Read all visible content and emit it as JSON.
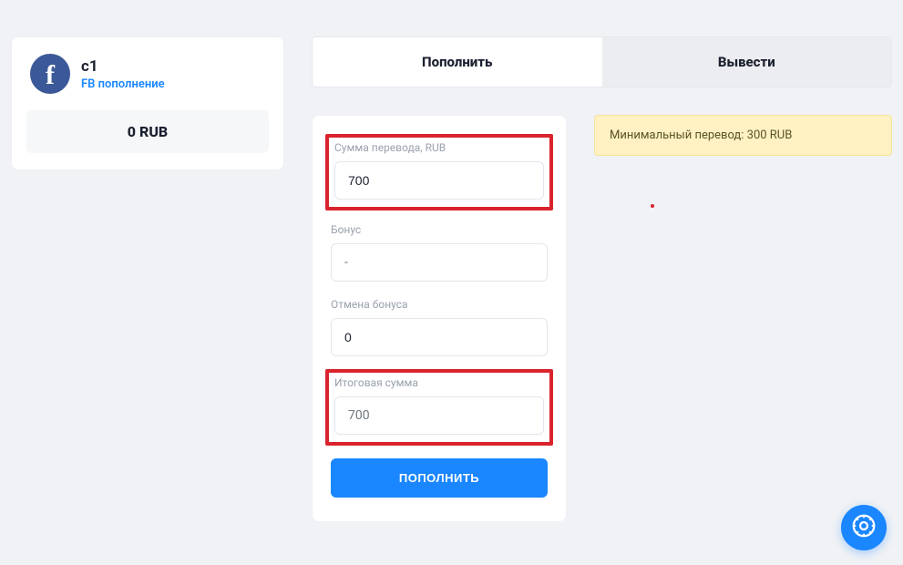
{
  "sidebar": {
    "title": "c1",
    "subtitle": "FB пополнение",
    "balance": "0 RUB",
    "icon_label": "f"
  },
  "tabs": {
    "deposit": "Пополнить",
    "withdraw": "Вывести"
  },
  "form": {
    "amount_label": "Сумма перевода, RUB",
    "amount_value": "700",
    "bonus_label": "Бонус",
    "bonus_value": "-",
    "bonus_cancel_label": "Отмена бонуса",
    "bonus_cancel_value": "0",
    "total_label": "Итоговая сумма",
    "total_value": "700",
    "submit_label": "Пополнить"
  },
  "notice": {
    "text": "Минимальный перевод: 300 RUB"
  },
  "colors": {
    "accent": "#1a86ff",
    "danger_highlight": "#d9232d",
    "notice_bg": "#fff1c2"
  }
}
